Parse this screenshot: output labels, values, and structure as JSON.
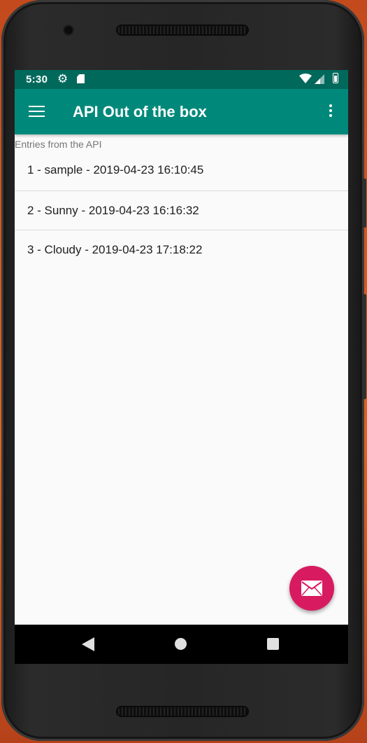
{
  "status_bar": {
    "time": "5:30",
    "icons": [
      "gear-icon",
      "sd-card-icon",
      "wifi-icon",
      "signal-icon",
      "battery-icon"
    ]
  },
  "app_bar": {
    "title": "API Out of the box",
    "left_icon": "menu-icon",
    "right_icon": "overflow-menu-icon",
    "color": "#00897b",
    "status_color": "#00695c"
  },
  "main": {
    "section_label": "Entries from the API",
    "entries": [
      "1 - sample - 2019-04-23 16:10:45",
      "2 - Sunny - 2019-04-23 16:16:32",
      "3 - Cloudy - 2019-04-23 17:18:22"
    ]
  },
  "fab": {
    "icon": "mail-icon",
    "color": "#d81b60"
  },
  "nav_bar": {
    "icons": [
      "back-icon",
      "home-icon",
      "recent-apps-icon"
    ]
  }
}
